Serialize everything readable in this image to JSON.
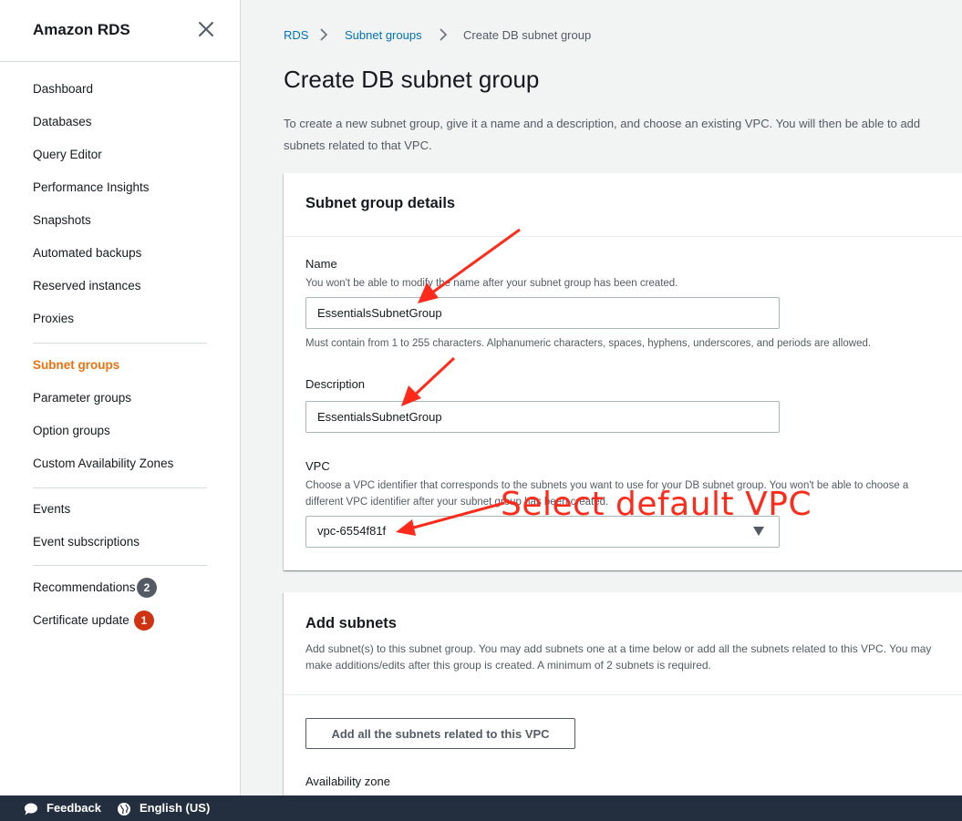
{
  "sidebar": {
    "title": "Amazon RDS",
    "items": [
      {
        "label": "Dashboard"
      },
      {
        "label": "Databases"
      },
      {
        "label": "Query Editor"
      },
      {
        "label": "Performance Insights"
      },
      {
        "label": "Snapshots"
      },
      {
        "label": "Automated backups"
      },
      {
        "label": "Reserved instances"
      },
      {
        "label": "Proxies"
      },
      {
        "label": "Subnet groups",
        "active": true
      },
      {
        "label": "Parameter groups"
      },
      {
        "label": "Option groups"
      },
      {
        "label": "Custom Availability Zones"
      },
      {
        "label": "Events"
      },
      {
        "label": "Event subscriptions"
      },
      {
        "label": "Recommendations",
        "badge": "2"
      },
      {
        "label": "Certificate update",
        "badge": "1"
      }
    ]
  },
  "breadcrumb": [
    "RDS",
    "Subnet groups",
    "Create DB subnet group"
  ],
  "page": {
    "title": "Create DB subnet group",
    "description": "To create a new subnet group, give it a name and a description, and choose an existing VPC. You will then be able to add subnets related to that VPC."
  },
  "details": {
    "title": "Subnet group details",
    "name_label": "Name",
    "name_desc": "You won't be able to modify the name after your subnet group has been created.",
    "name_value": "EssentialsSubnetGroup",
    "name_hint": "Must contain from 1 to 255 characters. Alphanumeric characters, spaces, hyphens, underscores, and periods are allowed.",
    "description_label": "Description",
    "description_value": "EssentialsSubnetGroup",
    "vpc_label": "VPC",
    "vpc_desc": "Choose a VPC identifier that corresponds to the subnets you want to use for your DB subnet group. You won't be able to choose a different VPC identifier after your subnet group has been created.",
    "vpc_value": "vpc-6554f81f"
  },
  "subnets": {
    "title": "Add subnets",
    "desc": "Add subnet(s) to this subnet group. You may add subnets one at a time below or add all the subnets related to this VPC. You may make additions/edits after this group is created. A minimum of 2 subnets is required.",
    "add_all_button": "Add all the subnets related to this VPC",
    "az_label": "Availability zone"
  },
  "annotation": {
    "text": "Select default VPC",
    "color": "#ff2a1a"
  },
  "footer": {
    "feedback": "Feedback",
    "language": "English (US)"
  },
  "colors": {
    "active_nav": "#ec7211",
    "link": "#0073bb",
    "footer_bg": "#232f3e",
    "badge_grey": "#545b64",
    "badge_red": "#d13212"
  }
}
